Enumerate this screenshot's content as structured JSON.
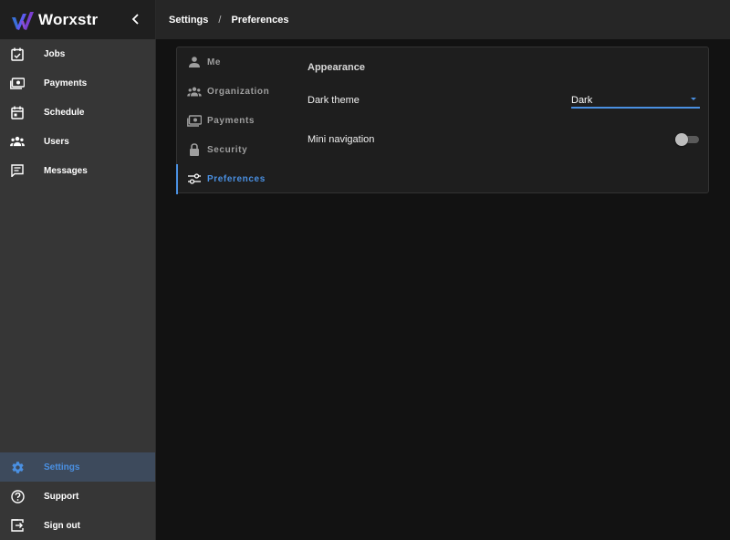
{
  "brand": {
    "name": "Worxstr"
  },
  "sidebar": {
    "items": [
      {
        "label": "Jobs",
        "icon": "calendar-check-icon"
      },
      {
        "label": "Payments",
        "icon": "cash-icon"
      },
      {
        "label": "Schedule",
        "icon": "calendar-icon"
      },
      {
        "label": "Users",
        "icon": "users-icon"
      },
      {
        "label": "Messages",
        "icon": "message-icon"
      }
    ],
    "bottom_items": [
      {
        "label": "Settings",
        "icon": "gear-icon",
        "active": true
      },
      {
        "label": "Support",
        "icon": "help-icon"
      },
      {
        "label": "Sign out",
        "icon": "sign-out-icon"
      }
    ]
  },
  "breadcrumb": {
    "root": "Settings",
    "separator": "/",
    "current": "Preferences"
  },
  "settings_nav": {
    "items": [
      {
        "label": "Me",
        "icon": "person-icon"
      },
      {
        "label": "Organization",
        "icon": "organization-icon"
      },
      {
        "label": "Payments",
        "icon": "cash-icon"
      },
      {
        "label": "Security",
        "icon": "lock-icon"
      },
      {
        "label": "Preferences",
        "icon": "sliders-icon",
        "active": true
      }
    ]
  },
  "preferences": {
    "section_title": "Appearance",
    "dark_theme": {
      "label": "Dark theme",
      "value": "Dark"
    },
    "mini_navigation": {
      "label": "Mini navigation",
      "enabled": false
    }
  },
  "colors": {
    "accent": "#4a90e2",
    "sidebar_bg": "#363636",
    "page_bg": "#121212",
    "panel_bg": "#1e1e1e"
  }
}
